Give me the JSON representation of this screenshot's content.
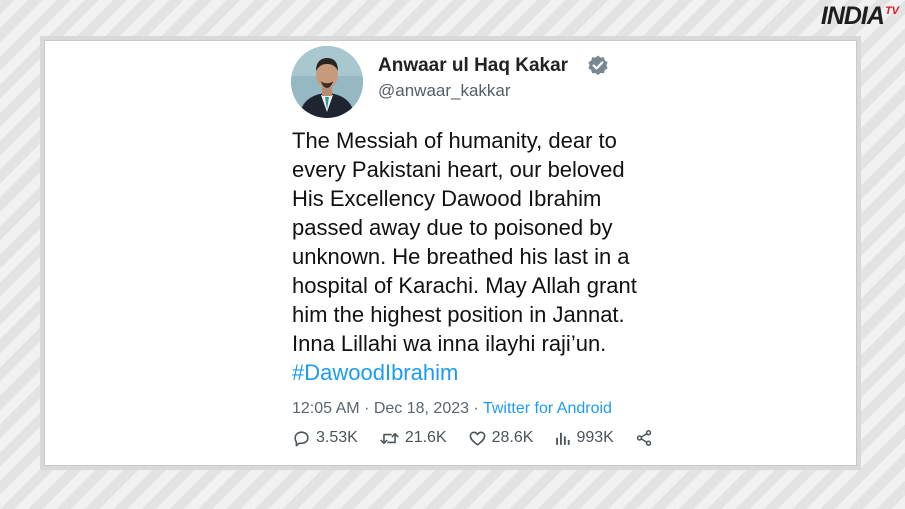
{
  "brand": {
    "logo_text": "INDIA",
    "logo_sub": "TV",
    "accent_color": "#d81f26"
  },
  "tweet": {
    "author_name": "Anwaar ul Haq Kakar",
    "handle": "@anwaar_kakkar",
    "verified": true,
    "body_lines": [
      "The Messiah of humanity, dear to",
      "every Pakistani heart, our beloved",
      "His Excellency Dawood Ibrahim",
      "passed away due to poisoned by",
      "unknown. He breathed his last in a",
      "hospital of Karachi. May Allah grant",
      "him the highest position in Jannat.",
      "Inna Lillahi wa inna ilayhi raji’un."
    ],
    "hashtag": "#DawoodIbrahim",
    "time": "12:05 AM",
    "date": "Dec 18, 2023",
    "separator": "·",
    "source": "Twitter for Android",
    "stats": {
      "replies": "3.53K",
      "retweets": "21.6K",
      "likes": "28.6K",
      "views": "993K"
    },
    "link_color": "#1d9bf0"
  }
}
